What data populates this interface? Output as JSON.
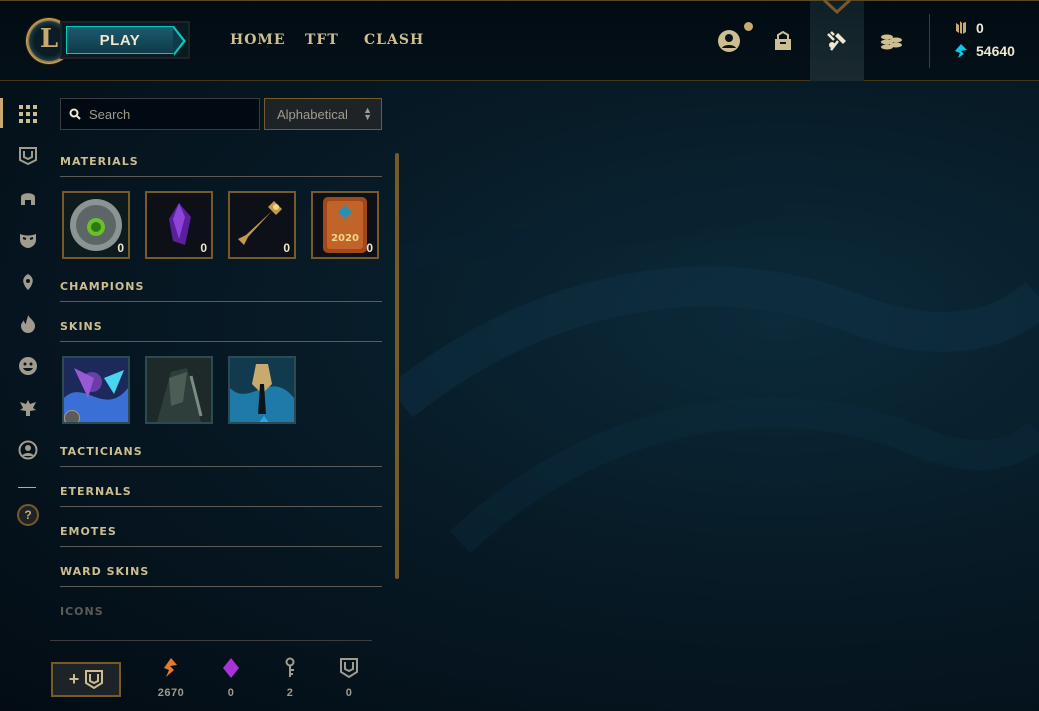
{
  "header": {
    "logo_letter": "L",
    "play_label": "PLAY",
    "nav": [
      {
        "label": "HOME"
      },
      {
        "label": "TFT"
      },
      {
        "label": "CLASH"
      }
    ],
    "icons": [
      "profile-icon",
      "collection-icon",
      "crafting-icon",
      "store-icon"
    ],
    "currencies": {
      "rp": "0",
      "blue_essence": "54640"
    }
  },
  "rail": {
    "items": [
      "all-grid-icon",
      "emporium-icon",
      "champion-helmet-icon",
      "skin-mask-icon",
      "tactician-icon",
      "eternals-icon",
      "emote-icon",
      "ward-icon",
      "profile-icon-icon"
    ],
    "help_label": "?"
  },
  "search": {
    "placeholder": "Search",
    "value": ""
  },
  "sort": {
    "selected": "Alphabetical"
  },
  "sections": {
    "materials": {
      "title": "MATERIALS",
      "items": [
        {
          "name": "mastery-token",
          "count": "0"
        },
        {
          "name": "mythic-essence-shard",
          "count": "0"
        },
        {
          "name": "hextech-key",
          "count": "0"
        },
        {
          "name": "2020-event-token",
          "count": "0",
          "label": "2020"
        }
      ]
    },
    "champions": {
      "title": "CHAMPIONS"
    },
    "skins": {
      "title": "SKINS"
    },
    "tacticians": {
      "title": "TACTICIANS"
    },
    "eternals": {
      "title": "ETERNALS"
    },
    "emotes": {
      "title": "EMOTES"
    },
    "ward_skins": {
      "title": "WARD SKINS"
    },
    "icons": {
      "title": "ICONS"
    }
  },
  "bottom": {
    "add_label": "+",
    "currencies": [
      {
        "icon": "orange-essence-icon",
        "value": "2670",
        "color": "#e8782a"
      },
      {
        "icon": "mythic-essence-icon",
        "value": "0",
        "color": "#a833d6"
      },
      {
        "icon": "key-fragment-icon",
        "value": "2",
        "color": "#a09b8c"
      },
      {
        "icon": "emporium-token-icon",
        "value": "0",
        "color": "#a09b8c"
      }
    ]
  },
  "colors": {
    "gold": "#c8aa6e",
    "gold_dark": "#785a28",
    "text": "#cdbe91",
    "teal": "#0ac8b9"
  }
}
